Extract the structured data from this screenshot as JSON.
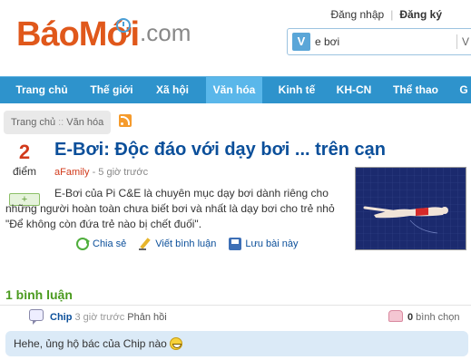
{
  "header": {
    "logo_bao": "Báo",
    "logo_moi": "Mới",
    "logo_dotcom": ".com",
    "login": "Đăng nhập",
    "separator": "|",
    "register": "Đăng ký",
    "search_badge": "V",
    "search_value": "e bơi",
    "search_right": "V"
  },
  "nav": {
    "items": [
      {
        "label": "Trang chủ"
      },
      {
        "label": "Thế giới"
      },
      {
        "label": "Xã hội"
      },
      {
        "label": "Văn hóa"
      },
      {
        "label": "Kinh tế"
      },
      {
        "label": "KH-CN"
      },
      {
        "label": "Thể thao"
      },
      {
        "label": "G"
      }
    ],
    "active_index": 3
  },
  "breadcrumb": {
    "home": "Trang chủ",
    "sep": "::",
    "current": "Văn hóa"
  },
  "article": {
    "score": "2",
    "score_label": "điểm",
    "plus": "+",
    "title": "E-Bơi: Độc đáo với dạy bơi ... trên cạn",
    "source": "aFamily",
    "time": " - 5 giờ trước",
    "desc_first": "E-Bơi của Pi C&E là chuyên mục dạy bơi dành riêng cho những người hoàn toàn chưa biết bơi và nhất là dạy bơi",
    "desc_rest": "cho trẻ nhỏ \"Để không còn đứa trẻ nào bị chết đuối\".",
    "share": "Chia sẻ",
    "write_comment": "Viết bình luận",
    "save": "Lưu bài này"
  },
  "comments": {
    "heading": "1 bình luận",
    "items": [
      {
        "author": "Chip",
        "time": "3 giờ trước",
        "reply": "Phản hồi",
        "likes_count": "0",
        "likes_label": " bình chọn",
        "text": "Hehe, ủng hộ bác của Chip nào"
      }
    ]
  },
  "colors": {
    "brand": "#e0581b",
    "nav": "#2e93cc",
    "nav_active": "#5ab7ea",
    "title": "#0b4f9a",
    "comment_bg": "#dbeaf7"
  }
}
